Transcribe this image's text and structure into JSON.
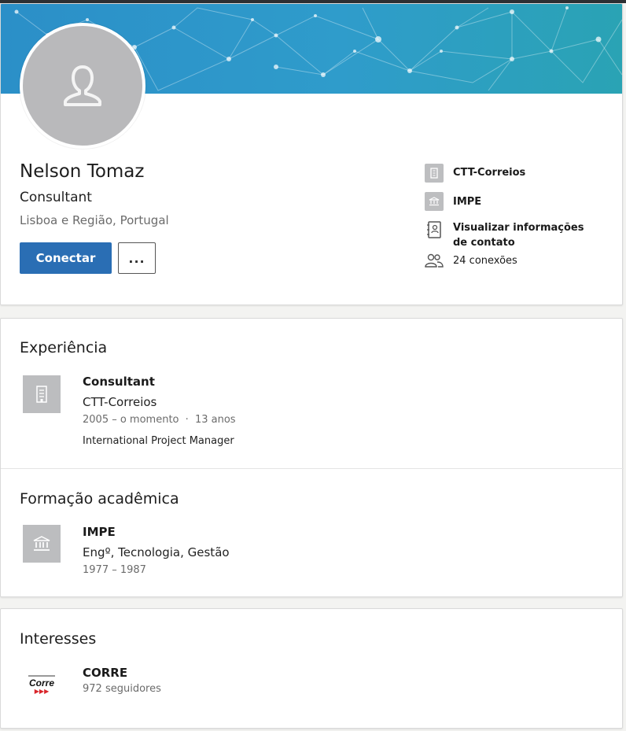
{
  "profile": {
    "name": "Nelson Tomaz",
    "headline": "Consultant",
    "location": "Lisboa e Região, Portugal",
    "connect_label": "Conectar",
    "more_label": "...",
    "avatar_icon": "person-icon"
  },
  "sidebar": {
    "company": "CTT-Correios",
    "school": "IMPE",
    "contact_info": "Visualizar informações de contato",
    "connections": "24 conexões"
  },
  "experience": {
    "title": "Experiência",
    "items": [
      {
        "role": "Consultant",
        "company": "CTT-Correios",
        "dates": "2005 – o momento",
        "duration": "13 anos",
        "separator": "·",
        "description": "International Project Manager"
      }
    ]
  },
  "education": {
    "title": "Formação acadêmica",
    "items": [
      {
        "school": "IMPE",
        "degree": "Engº, Tecnologia, Gestão",
        "dates": "1977 – 1987"
      }
    ]
  },
  "interests": {
    "title": "Interesses",
    "items": [
      {
        "name": "CORRE",
        "followers": "972 seguidores",
        "logo_text": "Corre"
      }
    ]
  },
  "colors": {
    "banner_start": "#2b8fc8",
    "banner_end": "#2aa3b4",
    "primary_button": "#2a6eb4",
    "logo_placeholder": "#bcbdbf",
    "logo_red": "#d9262b"
  }
}
